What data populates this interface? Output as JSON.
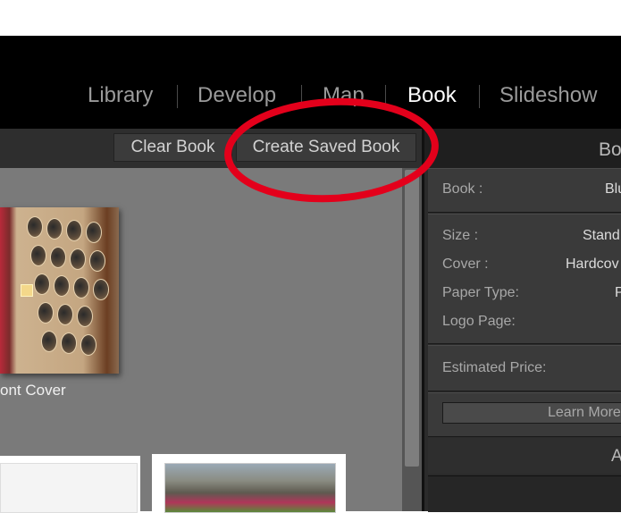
{
  "modules": {
    "library": "Library",
    "develop": "Develop",
    "map": "Map",
    "book": "Book",
    "slideshow": "Slideshow"
  },
  "toolbar": {
    "clear_book": "Clear Book",
    "create_saved_book": "Create Saved Book"
  },
  "canvas": {
    "cover_label": "ont Cover"
  },
  "right_panel": {
    "title": "Bo",
    "book_label": "Book :",
    "book_value": "Blu",
    "size_label": "Size :",
    "size_value": "Stand",
    "cover_label": "Cover :",
    "cover_value": "Hardcov",
    "paper_type_label": "Paper Type:",
    "paper_type_value": "P",
    "logo_page_label": "Logo Page:",
    "estimated_price_label": "Estimated Price:",
    "learn_more": "Learn More",
    "next_panel_label": "A"
  },
  "colors": {
    "annotation_red": "#e3001b",
    "active_module": "#ffffff",
    "inactive_module": "#9a9a9a"
  }
}
